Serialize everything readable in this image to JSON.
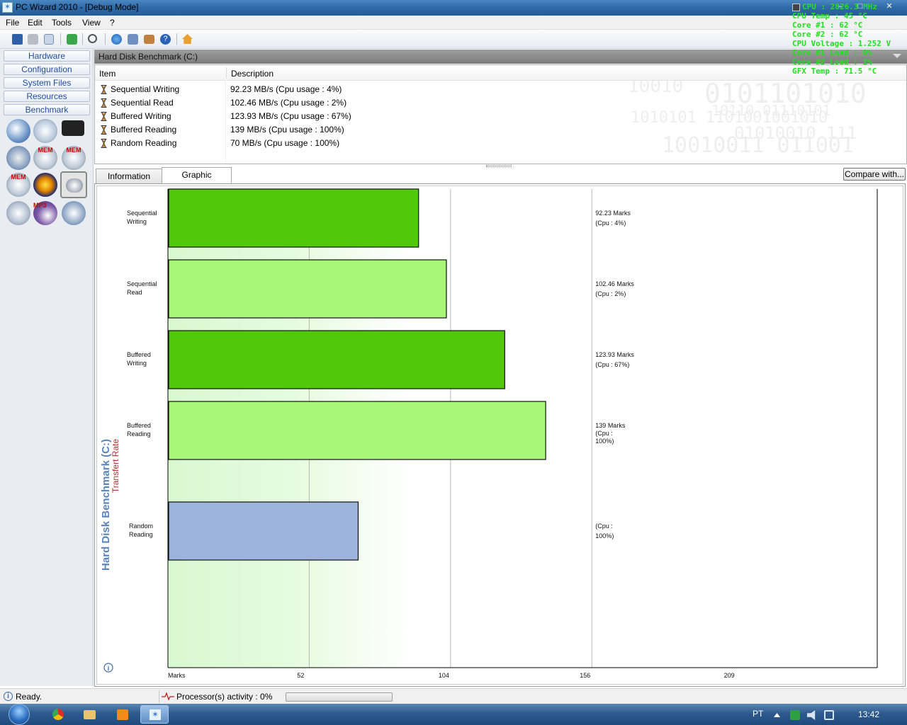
{
  "window": {
    "title": "PC Wizard 2010 - [Debug Mode]",
    "controls": [
      "–",
      "□",
      "✕"
    ]
  },
  "osd": {
    "lines": [
      "CPU : 2826.3 MHz",
      "CPU Temp : 45 °C",
      "Core #1 : 62 °C",
      "Core #2 : 62 °C",
      "CPU Voltage : 1.252 V",
      "Core #1 Load : 0%",
      "Core #2 Load : 1%",
      "GFX Temp : 71.5 °C"
    ],
    "color": "#20e020"
  },
  "menu": [
    "File",
    "Edit",
    "Tools",
    "View",
    "?"
  ],
  "toolbar": {
    "icons": [
      "save-icon",
      "print-icon",
      "copy-icon",
      "refresh-icon",
      "search-icon",
      "globe-icon",
      "network-icon",
      "photo-icon",
      "help-icon",
      "home-icon"
    ]
  },
  "sidebar": {
    "buttons": [
      "Hardware",
      "Configuration",
      "System Files",
      "Resources",
      "Benchmark"
    ],
    "benchmark_icons": [
      "cpu-benchmark-icon",
      "cache-benchmark-icon",
      "chip-benchmark-icon",
      "gears-benchmark-icon",
      "mem-benchmark-icon",
      "mem-graph-benchmark-icon",
      "mem-latency-benchmark-icon",
      "directx-benchmark-icon",
      "hard-disk-benchmark-icon",
      "cd-benchmark-icon",
      "mp3-benchmark-icon",
      "video-benchmark-icon"
    ],
    "mem_label": "MEM",
    "mp3_label": "MP3",
    "selected_icon": "hard-disk-benchmark-icon"
  },
  "panel": {
    "header": "Hard Disk Benchmark (C:)",
    "columns": [
      "Item",
      "Description"
    ],
    "rows": [
      {
        "item": "Sequential Writing",
        "description": "92.23 MB/s  (Cpu usage : 4%)"
      },
      {
        "item": "Sequential Read",
        "description": "102.46 MB/s  (Cpu usage : 2%)"
      },
      {
        "item": "Buffered Writing",
        "description": "123.93 MB/s  (Cpu usage : 67%)"
      },
      {
        "item": "Buffered Reading",
        "description": "139 MB/s  (Cpu usage : 100%)"
      },
      {
        "item": "Random Reading",
        "description": "70 MB/s  (Cpu usage : 100%)"
      }
    ],
    "watermark": [
      "10010",
      "0101101010",
      "1010101  1101001001010",
      "10110  01110101",
      "01010010  111",
      "10010011  011001"
    ]
  },
  "tabs": [
    "Information",
    "Graphic"
  ],
  "active_tab": "Graphic",
  "compare_button": "Compare with...",
  "chart_data": {
    "type": "bar",
    "orientation": "horizontal",
    "title": "Hard Disk Benchmark (C:)",
    "subtitle": "Transfert Rate",
    "xlabel": "Marks",
    "xlim": [
      0,
      261
    ],
    "xticks": [
      52,
      104,
      156,
      209
    ],
    "grid": true,
    "categories": [
      [
        "Sequential",
        "Writing"
      ],
      [
        "Sequential",
        "Read"
      ],
      [
        "Buffered",
        "Writing"
      ],
      [
        "Buffered",
        "Reading"
      ],
      [
        "Random",
        "Reading"
      ]
    ],
    "values": [
      92.23,
      102.46,
      123.93,
      139,
      70
    ],
    "bar_colors": [
      "#52c80a",
      "#a8f878",
      "#52c80a",
      "#a8f878",
      "#9cb4dc"
    ],
    "data_labels": [
      [
        "92.23 Marks",
        "(Cpu : 4%)"
      ],
      [
        "102.46 Marks",
        "(Cpu : 2%)"
      ],
      [
        "123.93 Marks",
        "(Cpu : 67%)"
      ],
      [
        "139 Marks",
        "(Cpu :",
        "100%)"
      ],
      [
        "(Cpu :",
        "100%)"
      ]
    ],
    "title_color": "#5a84b8",
    "subtitle_color": "#b03030"
  },
  "status": {
    "ready": "Ready.",
    "activity": "Processor(s) activity : 0%",
    "activity_value": 0
  },
  "taskbar": {
    "apps": [
      "chrome-icon",
      "folder-icon",
      "media-player-icon",
      "pc-wizard-icon"
    ],
    "language": "PT",
    "clock": "13:42"
  }
}
